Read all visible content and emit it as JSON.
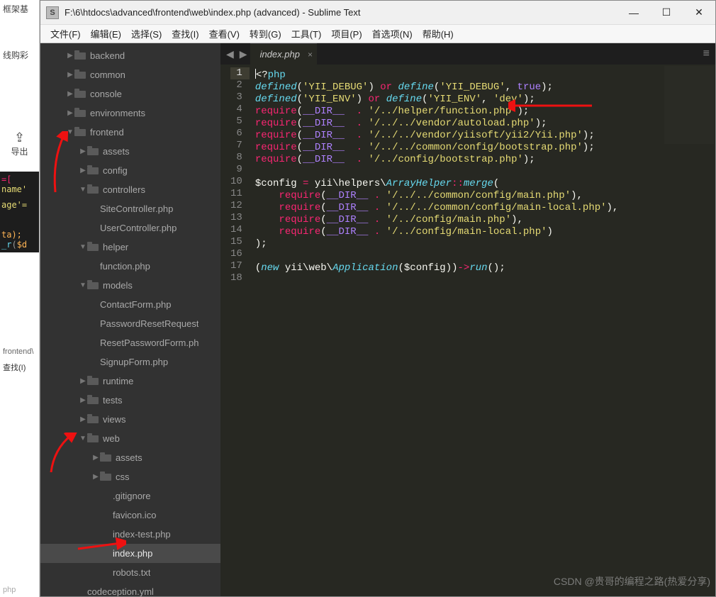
{
  "window": {
    "title": "F:\\6\\htdocs\\advanced\\frontend\\web\\index.php (advanced) - Sublime Text",
    "app_icon_letter": "S"
  },
  "leftpane": {
    "fragment1": "框架基",
    "fragment2": "线购彩",
    "upload_icon": "⇪",
    "upload_label": "导出",
    "code1": "=[",
    "code2": "name'",
    "code3": "age'=",
    "code4": "ta);",
    "code5": "_r($d",
    "fragment3": "frontend\\",
    "fragment4": "查找(I)",
    "fragment5": "php"
  },
  "menu": [
    {
      "label": "文件(F)"
    },
    {
      "label": "编辑(E)"
    },
    {
      "label": "选择(S)"
    },
    {
      "label": "查找(I)"
    },
    {
      "label": "查看(V)"
    },
    {
      "label": "转到(G)"
    },
    {
      "label": "工具(T)"
    },
    {
      "label": "项目(P)"
    },
    {
      "label": "首选项(N)"
    },
    {
      "label": "帮助(H)"
    }
  ],
  "sidebar": {
    "tree": [
      {
        "depth": 1,
        "arrow": "▶",
        "folder": true,
        "label": "backend"
      },
      {
        "depth": 1,
        "arrow": "▶",
        "folder": true,
        "label": "common"
      },
      {
        "depth": 1,
        "arrow": "▶",
        "folder": true,
        "label": "console"
      },
      {
        "depth": 1,
        "arrow": "▶",
        "folder": true,
        "label": "environments"
      },
      {
        "depth": 1,
        "arrow": "▼",
        "folder": true,
        "label": "frontend"
      },
      {
        "depth": 2,
        "arrow": "▶",
        "folder": true,
        "label": "assets"
      },
      {
        "depth": 2,
        "arrow": "▶",
        "folder": true,
        "label": "config"
      },
      {
        "depth": 2,
        "arrow": "▼",
        "folder": true,
        "label": "controllers"
      },
      {
        "depth": 3,
        "arrow": "",
        "folder": false,
        "label": "SiteController.php"
      },
      {
        "depth": 3,
        "arrow": "",
        "folder": false,
        "label": "UserController.php"
      },
      {
        "depth": 2,
        "arrow": "▼",
        "folder": true,
        "label": "helper"
      },
      {
        "depth": 3,
        "arrow": "",
        "folder": false,
        "label": "function.php"
      },
      {
        "depth": 2,
        "arrow": "▼",
        "folder": true,
        "label": "models"
      },
      {
        "depth": 3,
        "arrow": "",
        "folder": false,
        "label": "ContactForm.php"
      },
      {
        "depth": 3,
        "arrow": "",
        "folder": false,
        "label": "PasswordResetRequest"
      },
      {
        "depth": 3,
        "arrow": "",
        "folder": false,
        "label": "ResetPasswordForm.ph"
      },
      {
        "depth": 3,
        "arrow": "",
        "folder": false,
        "label": "SignupForm.php"
      },
      {
        "depth": 2,
        "arrow": "▶",
        "folder": true,
        "label": "runtime"
      },
      {
        "depth": 2,
        "arrow": "▶",
        "folder": true,
        "label": "tests"
      },
      {
        "depth": 2,
        "arrow": "▶",
        "folder": true,
        "label": "views"
      },
      {
        "depth": 2,
        "arrow": "▼",
        "folder": true,
        "label": "web"
      },
      {
        "depth": 3,
        "arrow": "▶",
        "folder": true,
        "label": "assets"
      },
      {
        "depth": 3,
        "arrow": "▶",
        "folder": true,
        "label": "css"
      },
      {
        "depth": 4,
        "arrow": "",
        "folder": false,
        "label": ".gitignore"
      },
      {
        "depth": 4,
        "arrow": "",
        "folder": false,
        "label": "favicon.ico"
      },
      {
        "depth": 4,
        "arrow": "",
        "folder": false,
        "label": "index-test.php"
      },
      {
        "depth": 4,
        "arrow": "",
        "folder": false,
        "label": "index.php",
        "selected": true
      },
      {
        "depth": 4,
        "arrow": "",
        "folder": false,
        "label": "robots.txt"
      },
      {
        "depth": 2,
        "arrow": "",
        "folder": false,
        "label": "codeception.yml"
      }
    ]
  },
  "tab": {
    "label": "index.php"
  },
  "code": {
    "lines": 18
  },
  "watermark": "CSDN @贵哥的编程之路(热爱分享)"
}
